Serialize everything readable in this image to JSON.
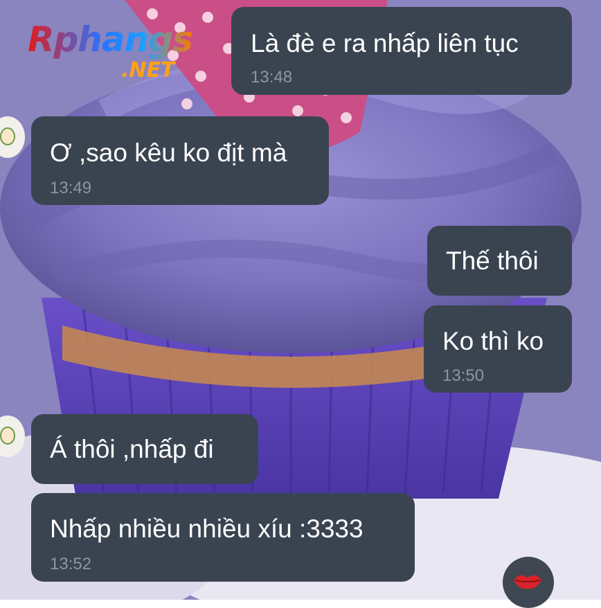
{
  "watermark": {
    "brand": "Rphangs",
    "domain": ".NET"
  },
  "messages": [
    {
      "side": "right",
      "text": "Là đè e ra nhấp liên tục",
      "time": "13:48"
    },
    {
      "side": "left",
      "text": "Ơ ,sao kêu ko địt mà",
      "time": "13:49"
    },
    {
      "side": "right",
      "text": "Thế thôi",
      "time": ""
    },
    {
      "side": "right",
      "text": "Ko thì ko",
      "time": "13:50"
    },
    {
      "side": "left",
      "text": "Á thôi ,nhấp đi",
      "time": ""
    },
    {
      "side": "left",
      "text": "Nhấp nhiều nhiều xíu :3333",
      "time": "13:52"
    }
  ],
  "composer": {
    "emoji_icon": "kiss-lips-icon"
  },
  "colors": {
    "bubble": "#3a4451",
    "timestamp": "#8d96a3",
    "text": "#ffffff"
  }
}
